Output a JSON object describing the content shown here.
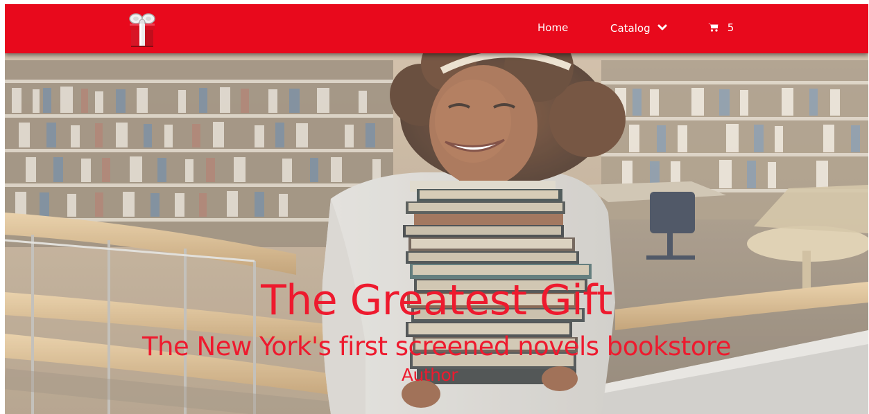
{
  "nav": {
    "logo": "gift-box-icon",
    "home_label": "Home",
    "catalog_label": "Catalog",
    "catalog_icon": "chevron-down-icon",
    "cart_icon": "shopping-cart-icon",
    "cart_count": "5"
  },
  "hero": {
    "title": "The Greatest Gift",
    "subtitle": "The New York's first screened novels bookstore",
    "author": "Author"
  },
  "colors": {
    "brand_red": "#e8091c",
    "hero_text": "#ee1a2e"
  }
}
